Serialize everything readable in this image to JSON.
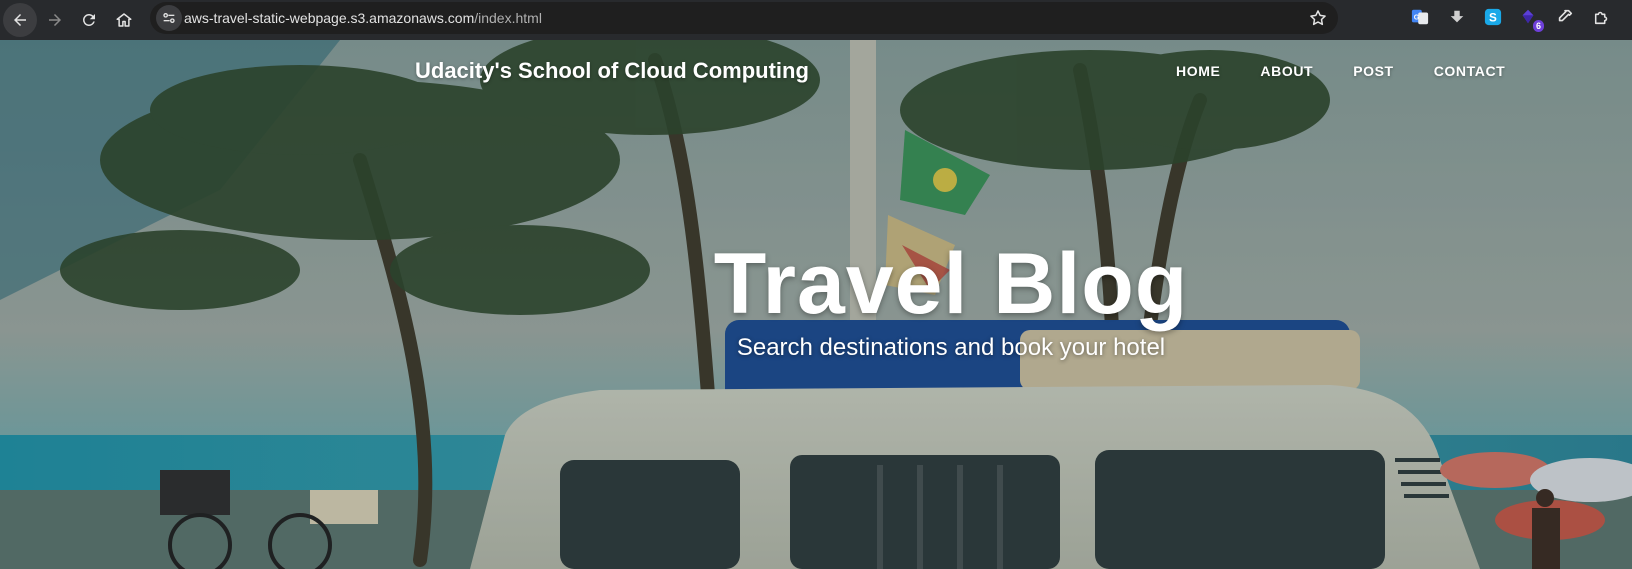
{
  "browser": {
    "url_host": "aws-travel-static-webpage.s3.amazonaws.com",
    "url_path": "/index.html",
    "toolbar_icons": [
      "back-icon",
      "forward-icon",
      "reload-icon",
      "home-icon",
      "site-info-icon",
      "bookmark-star-icon"
    ],
    "extensions": [
      {
        "name": "google-translate-icon"
      },
      {
        "name": "download-arrow-icon"
      },
      {
        "name": "s-extension-icon"
      },
      {
        "name": "purple-gem-icon",
        "badge": "6"
      },
      {
        "name": "eyedropper-icon"
      },
      {
        "name": "puzzle-extensions-icon"
      }
    ]
  },
  "site": {
    "brand": "Udacity's School of Cloud Computing",
    "nav": [
      {
        "label": "HOME"
      },
      {
        "label": "ABOUT"
      },
      {
        "label": "POST"
      },
      {
        "label": "CONTACT"
      }
    ]
  },
  "hero": {
    "title": "Travel Blog",
    "subtitle": "Search destinations and book your hotel"
  },
  "colors": {
    "toolbar_bg": "#282a2d",
    "omnibox_bg": "#1f1f1f",
    "text_white": "#ffffff",
    "badge_purple": "#6e3fd9"
  }
}
